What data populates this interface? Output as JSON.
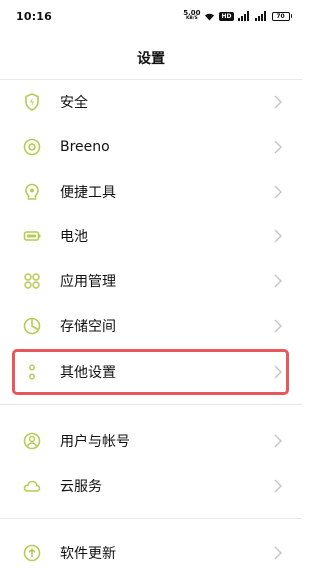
{
  "status_bar": {
    "time": "10:16",
    "net_speed_value": "5.00",
    "net_speed_unit": "KB/S",
    "hd_label": "HD",
    "battery_level": "70",
    "icons": [
      "wifi-icon",
      "hd-icon",
      "signal-4g-icon",
      "signal-5g-icon",
      "battery-icon"
    ]
  },
  "header": {
    "title": "设置"
  },
  "settings": {
    "items": [
      {
        "label": "安全",
        "icon": "shield-icon"
      },
      {
        "label": "Breeno",
        "icon": "breeno-icon"
      },
      {
        "label": "便捷工具",
        "icon": "convenience-tools-icon"
      },
      {
        "label": "电池",
        "icon": "battery-icon"
      },
      {
        "label": "应用管理",
        "icon": "app-grid-icon"
      },
      {
        "label": "存储空间",
        "icon": "storage-pie-icon"
      },
      {
        "label": "其他设置",
        "icon": "more-dots-icon",
        "highlighted": true
      },
      {
        "label": "用户与帐号",
        "icon": "user-account-icon"
      },
      {
        "label": "云服务",
        "icon": "cloud-icon"
      },
      {
        "label": "软件更新",
        "icon": "update-arrow-icon"
      }
    ]
  },
  "colors": {
    "icon_accent": "#b7cc55",
    "highlight": "#e8575a",
    "chevron": "#c4c4c4",
    "divider": "#e8e8e8"
  }
}
